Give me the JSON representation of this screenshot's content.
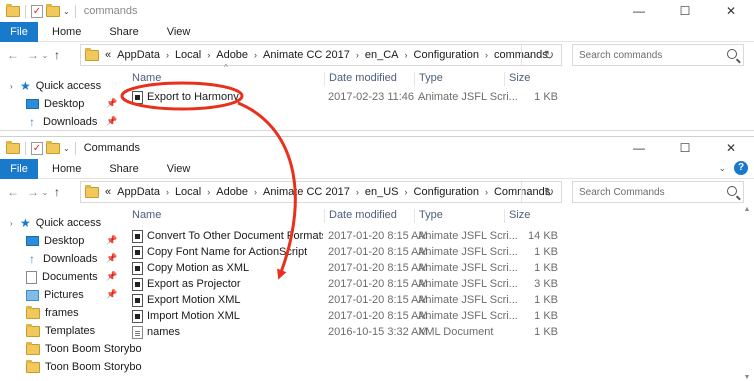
{
  "colors": {
    "accent": "#1979ca",
    "annotation": "#e8301c",
    "folder": "#f1c85b"
  },
  "icons": {
    "back": "←",
    "forward": "→",
    "up": "↑",
    "chevron": "›",
    "dropdown": "⌄",
    "refresh": "↻",
    "pin": "📌",
    "star": "★",
    "minimize": "—",
    "maximize": "☐",
    "close": "✕",
    "expand": "›",
    "sort_up": "^",
    "check": "✓",
    "help": "?"
  },
  "win1": {
    "title": "commands",
    "ribbon": {
      "file": "File",
      "tabs": [
        "Home",
        "Share",
        "View"
      ]
    },
    "address": {
      "prefix": "«",
      "crumbs": [
        "AppData",
        "Local",
        "Adobe",
        "Animate CC 2017",
        "en_CA",
        "Configuration",
        "commands"
      ]
    },
    "search": {
      "placeholder": "Search commands"
    },
    "nav": [
      {
        "label": "Quick access"
      },
      {
        "label": "Desktop"
      },
      {
        "label": "Downloads"
      }
    ],
    "columns": {
      "name": "Name",
      "date": "Date modified",
      "type": "Type",
      "size": "Size"
    },
    "files": [
      {
        "name": "Export to Harmony",
        "date": "2017-02-23 11:46 ...",
        "type": "Animate JSFL Scri...",
        "size": "1 KB"
      }
    ]
  },
  "win2": {
    "title": "Commands",
    "ribbon": {
      "file": "File",
      "tabs": [
        "Home",
        "Share",
        "View"
      ]
    },
    "address": {
      "prefix": "«",
      "crumbs": [
        "AppData",
        "Local",
        "Adobe",
        "Animate CC 2017",
        "en_US",
        "Configuration",
        "Commands"
      ]
    },
    "search": {
      "placeholder": "Search Commands"
    },
    "nav": [
      {
        "label": "Quick access"
      },
      {
        "label": "Desktop"
      },
      {
        "label": "Downloads"
      },
      {
        "label": "Documents"
      },
      {
        "label": "Pictures"
      },
      {
        "label": "frames"
      },
      {
        "label": "Templates"
      },
      {
        "label": "Toon Boom Storybo"
      },
      {
        "label": "Toon Boom Storybo"
      }
    ],
    "columns": {
      "name": "Name",
      "date": "Date modified",
      "type": "Type",
      "size": "Size"
    },
    "files": [
      {
        "name": "Convert To Other Document Formats",
        "date": "2017-01-20 8:15 AM",
        "type": "Animate JSFL Scri...",
        "size": "14 KB"
      },
      {
        "name": "Copy Font Name for ActionScript",
        "date": "2017-01-20 8:15 AM",
        "type": "Animate JSFL Scri...",
        "size": "1 KB"
      },
      {
        "name": "Copy Motion as XML",
        "date": "2017-01-20 8:15 AM",
        "type": "Animate JSFL Scri...",
        "size": "1 KB"
      },
      {
        "name": "Export as Projector",
        "date": "2017-01-20 8:15 AM",
        "type": "Animate JSFL Scri...",
        "size": "3 KB"
      },
      {
        "name": "Export Motion XML",
        "date": "2017-01-20 8:15 AM",
        "type": "Animate JSFL Scri...",
        "size": "1 KB"
      },
      {
        "name": "Import Motion XML",
        "date": "2017-01-20 8:15 AM",
        "type": "Animate JSFL Scri...",
        "size": "1 KB"
      },
      {
        "name": "names",
        "date": "2016-10-15 3:32 AM",
        "type": "XML Document",
        "size": "1 KB"
      }
    ]
  }
}
